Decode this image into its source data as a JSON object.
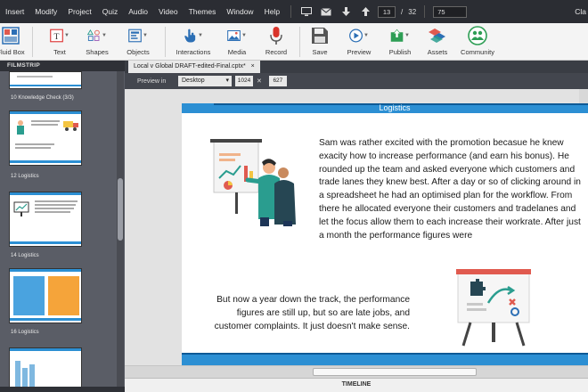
{
  "menubar": {
    "items": [
      "Insert",
      "Modify",
      "Project",
      "Quiz",
      "Audio",
      "Video",
      "Themes",
      "Window",
      "Help"
    ],
    "current_slide": "13",
    "slide_separator": "/",
    "total_slides": "32",
    "zoom": "75",
    "right_label": "Cla"
  },
  "toolbar": {
    "fluid_box": "Fluid Box",
    "text": "Text",
    "shapes": "Shapes",
    "objects": "Objects",
    "interactions": "Interactions",
    "media": "Media",
    "record": "Record",
    "save": "Save",
    "preview": "Preview",
    "publish": "Publish",
    "assets": "Assets",
    "community": "Community"
  },
  "filmstrip": {
    "header": "FILMSTRIP",
    "slides": [
      {
        "label": "10 Knowledge Check (3/3)"
      },
      {
        "label": "12 Logistics"
      },
      {
        "label": "14 Logistics"
      },
      {
        "label": "16 Logistics"
      }
    ]
  },
  "document": {
    "tab_title": "Local v Global DRAFT-edited-Final.cptx*",
    "preview_label": "Preview in",
    "device": "Desktop",
    "width": "1024",
    "height": "627"
  },
  "slide": {
    "title": "Logistics",
    "paragraph1": "Sam was rather excited with the promotion becasue he knew exacity how to increase performance (and earn his bonus). He rounded up the team and asked everyone which customers and trade lanes they knew best. After a day or so of clicking around in a spreadsheet he had an optimised plan for the workflow. From there he allocated everyone their customers and tradelanes and let the focus allow them to each increase their workrate. After just a month the performance figures were",
    "paragraph2": "But now a year down the track, the performance figures are still up, but so are late jobs, and customer complaints. It just doesn't make sense."
  },
  "timeline": {
    "label": "TIMELINE"
  },
  "colors": {
    "accent": "#2c8fd3",
    "accent_dark": "#0e5a96",
    "menubar_bg": "#2b2d33",
    "filmstrip_bg": "#5a5d66"
  }
}
